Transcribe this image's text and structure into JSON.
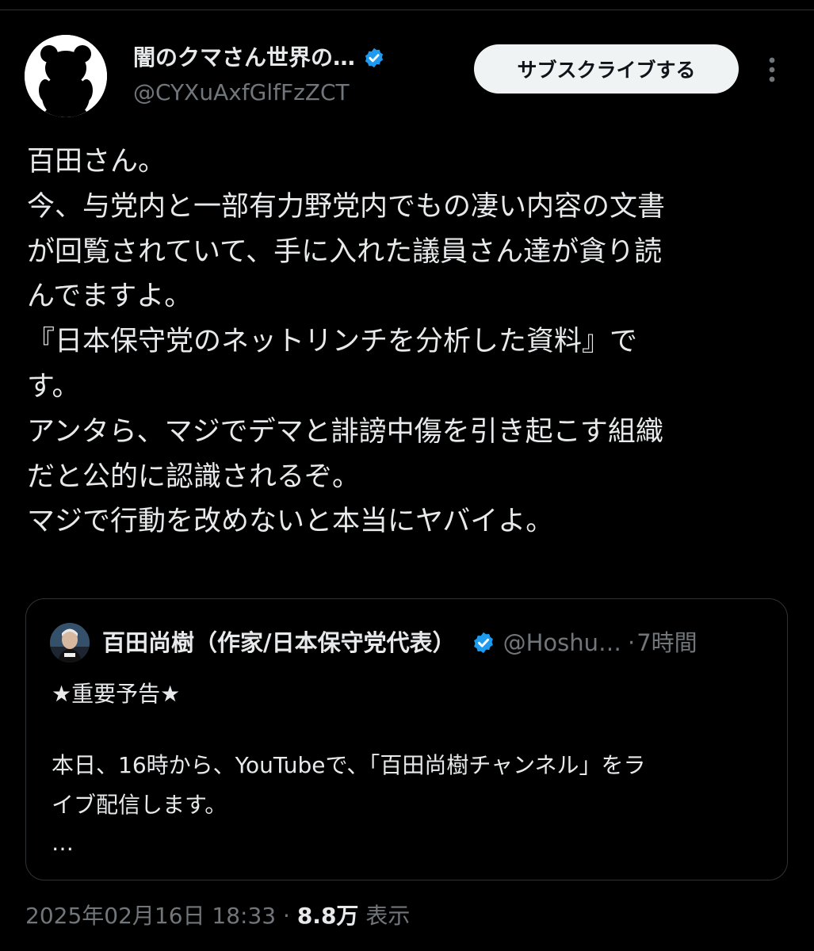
{
  "post": {
    "author": {
      "display_name": "闇のクマさん世界の…",
      "handle": "@CYXuAxfGlfFzZCT",
      "verified": true,
      "avatar_icon": "bear-silhouette-icon"
    },
    "subscribe_label": "サブスクライブする",
    "body_lines": [
      "百田さん。",
      "今、与党内と一部有力野党内でもの凄い内容の文書",
      "が回覧されていて、手に入れた議員さん達が貪り読",
      "んでますよ。",
      "『日本保守党のネットリンチを分析した資料』で",
      "す。",
      "アンタら、マジでデマと誹謗中傷を引き起こす組織",
      "だと公的に認識されるぞ。",
      "マジで行動を改めないと本当にヤバイよ。"
    ],
    "quote": {
      "display_name": "百田尚樹（作家/日本保守党代表）",
      "handle": "@Hoshu…",
      "separator": "·",
      "time": "7時間",
      "verified": true,
      "lines": [
        "★重要予告★",
        "本日、16時から、YouTubeで、「百田尚樹チャンネル」をラ",
        "イブ配信します。",
        "…"
      ]
    },
    "footer": {
      "timestamp": "2025年02月16日 18:33",
      "separator": "·",
      "views_count": "8.8万",
      "views_label": "表示"
    }
  },
  "colors": {
    "background": "#000000",
    "text_primary": "#e7e9ea",
    "text_secondary": "#71767b",
    "verified_blue": "#1d9bf0",
    "border": "#2f3336",
    "button_bg": "#eff3f4"
  }
}
